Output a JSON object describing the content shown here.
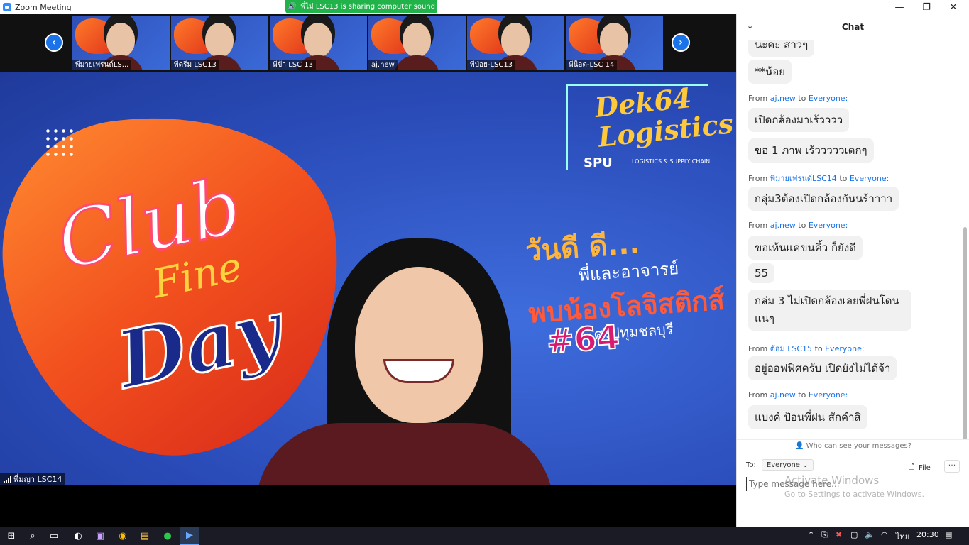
{
  "window": {
    "title": "Zoom Meeting",
    "share_banner": "พี่ไม่ LSC13 is sharing computer sound",
    "minimize": "—",
    "restore": "❐",
    "close": "✕"
  },
  "thumbnails": {
    "prev": "‹",
    "next": "›",
    "items": [
      {
        "name": "พี่มายเฟรนด์LS..."
      },
      {
        "name": "พี่ดรีม LSC13"
      },
      {
        "name": "พี่ข้า LSC 13"
      },
      {
        "name": "aj.new"
      },
      {
        "name": "พี่ป่อย-LSC13"
      },
      {
        "name": "พี่น็อต-LSC 14"
      }
    ]
  },
  "speaker": {
    "name": "พี่มญา LSC14",
    "bg_text": {
      "club": "Club",
      "fine": "Fine",
      "day": "Day",
      "dek": "Dek64",
      "logistics": "Logistics",
      "spu": "SPU",
      "log_sub": "LOGISTICS & SUPPLY CHAIN",
      "wan": "วันดี ดี...",
      "phi": "พี่และอาจารย์",
      "phob": "พบน้องโลจิสติกส์",
      "sri": "ศรีปทุมชลบุรี",
      "num": "#64"
    }
  },
  "chat": {
    "title": "Chat",
    "messages": [
      {
        "kind": "msg",
        "text": "นะคะ สาวๆ"
      },
      {
        "kind": "msg",
        "text": "**น้อย"
      },
      {
        "kind": "from",
        "sender": "aj.new",
        "to": "Everyone:"
      },
      {
        "kind": "msg",
        "text": "เปิดกล้องมาเร้วววว"
      },
      {
        "kind": "msg",
        "text": "ขอ 1 ภาพ เร้วววววเดกๆ"
      },
      {
        "kind": "from",
        "sender": "พี่มายเฟรนด์LSC14",
        "to": "Everyone:"
      },
      {
        "kind": "msg",
        "text": "กลุ่ม3ต้องเปิดกล้องกันนร้าาาา"
      },
      {
        "kind": "from",
        "sender": "aj.new",
        "to": "Everyone:"
      },
      {
        "kind": "msg",
        "text": "ขอเห้นแค่ขนคิ้ว ก็ยังดี"
      },
      {
        "kind": "msg",
        "text": "55"
      },
      {
        "kind": "msg",
        "text": "กล่ม 3 ไม่เปิดกล้องเลยพี่ฝนโดนแน่ๆ"
      },
      {
        "kind": "from",
        "sender": "ต้อม LSC15",
        "to": "Everyone:"
      },
      {
        "kind": "msg",
        "text": "อยู่ออฟฟิศครับ เปิดยังไม่ได้จ้า"
      },
      {
        "kind": "from",
        "sender": "aj.new",
        "to": "Everyone:"
      },
      {
        "kind": "msg",
        "text": "แบงค์ ป้อนพี่ฝน สักคำสิ"
      }
    ],
    "from_label": "From",
    "to_label_word": "to",
    "who_can_see": "Who can see your messages?",
    "to_label": "To:",
    "to_value": "Everyone",
    "file_label": "File",
    "more": "···",
    "input_placeholder": "Type message here...",
    "activate_title": "Activate Windows",
    "activate_sub": "Go to Settings to activate Windows."
  },
  "taskbar": {
    "time": "20:30",
    "lang": "ไทย"
  }
}
